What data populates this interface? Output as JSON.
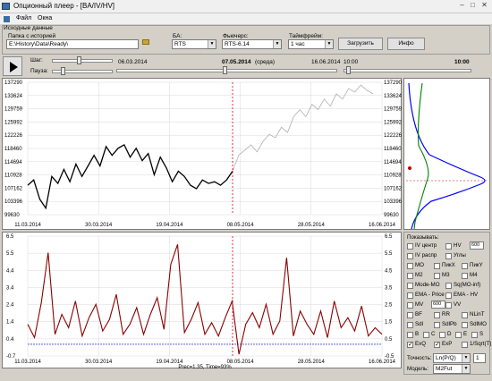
{
  "window": {
    "title": "Опционный плеер - [BA/IV/HV]"
  },
  "menu": [
    "Файл",
    "Окна"
  ],
  "source": {
    "group_label": "Исходные данные",
    "folder_label": "Папка с историей",
    "folder_value": "E:\\History\\Data\\Ready\\",
    "ba_label": "БА:",
    "ba_value": "RTS",
    "futures_label": "Фьючерс:",
    "futures_value": "RTS-6.14",
    "timeframe_label": "Таймфрейм:",
    "timeframe_value": "1 час",
    "load_button": "Загрузить",
    "info_button": "Инфо"
  },
  "player": {
    "step_label": "Шаг:",
    "pause_label": "Пауза:",
    "start_date": "06.03.2014",
    "current_date": "07.05.2014",
    "weekday": "(среда)",
    "end_date": "16.06.2014",
    "time_start": "10:00",
    "time_current": "10:00"
  },
  "top_chart": {
    "y_ticks": [
      "137290",
      "133624",
      "129759",
      "125992",
      "122226",
      "118460",
      "114694",
      "110928",
      "107162",
      "103396",
      "99630"
    ],
    "x_ticks": [
      "11.03.2014",
      "30.03.2014",
      "19.04.2014",
      "08.05.2014",
      "28.05.2014",
      "16.06.2014"
    ],
    "colors": {
      "history": "#000000",
      "future": "#b0b0b0",
      "cursor": "#e00000"
    },
    "chart_data": {
      "type": "line",
      "series": [
        {
          "values": [
            108000,
            109500,
            104000,
            101500,
            110500,
            108500,
            112500,
            109000,
            114000,
            110500,
            113500,
            116500,
            113500,
            119000,
            116500,
            118500,
            119500,
            116000,
            118500,
            115000,
            117000,
            111000,
            116000,
            113000,
            109000,
            112000,
            110500,
            108000,
            107000,
            109500,
            108500,
            109000,
            108000,
            109500,
            112000
          ]
        },
        {
          "values": [
            112000,
            116500,
            118000,
            119500,
            117500,
            120500,
            122500,
            121500,
            124500,
            123000,
            127500,
            129500,
            127500,
            131000,
            129500,
            132500,
            130500,
            134000,
            132500,
            135500,
            134500,
            136500,
            135000,
            134000
          ]
        }
      ]
    }
  },
  "bottom_chart": {
    "left_ticks": [
      "6.5",
      "5.5",
      "4.4",
      "3.4",
      "2.4",
      "1.4",
      "0.4",
      "-0.7"
    ],
    "right_ticks": [
      "6.5",
      "5.5",
      "4.5",
      "3.5",
      "2.5",
      "1.5",
      "0.5",
      "-0.5"
    ],
    "x_ticks": [
      "11.03.2014",
      "30.03.2014",
      "19.04.2014",
      "08.05.2014",
      "28.05.2014",
      "16.06.2014"
    ],
    "status": "Prec=1.35, Time=93%",
    "colors": {
      "line": "#8b0000",
      "zero": "#0000c0",
      "cursor": "#e00000"
    },
    "chart_data": {
      "type": "line",
      "series": [
        {
          "values": [
            1.2,
            0.4,
            2.5,
            5.5,
            0.6,
            1.8,
            1.0,
            2.6,
            0.5,
            1.6,
            2.4,
            0.8,
            1.5,
            3.0,
            0.6,
            1.2,
            2.2,
            0.6,
            1.8,
            2.8,
            0.9,
            4.8,
            6.0,
            0.7,
            1.5,
            2.5,
            0.6,
            1.3,
            0.5,
            1.6,
            2.6,
            -0.6,
            1.2,
            1.9,
            1.0,
            2.4,
            0.6,
            1.4,
            5.2,
            0.5,
            2.0,
            1.2,
            0.6,
            2.0,
            0.4,
            2.6,
            1.0,
            1.6,
            0.8,
            2.3,
            0.5,
            1.0,
            0.6
          ]
        }
      ]
    }
  },
  "display": {
    "title": "Показывать:",
    "rows": [
      [
        {
          "label": "IV центр",
          "on": false
        },
        {
          "label": "HV",
          "on": false,
          "value": "600"
        }
      ],
      [
        {
          "label": "IV распр",
          "on": false
        },
        {
          "label": "Углы",
          "on": false
        }
      ],
      [
        {
          "label": "MO",
          "on": false
        },
        {
          "label": "ПикX",
          "on": false
        },
        {
          "label": "ПикY",
          "on": false
        }
      ],
      [
        {
          "label": "M2",
          "on": false
        },
        {
          "label": "M3",
          "on": false
        },
        {
          "label": "M4",
          "on": false
        }
      ],
      [
        {
          "label": "Mode-MO",
          "on": false
        },
        {
          "label": "Sq(MO-inf)",
          "on": false
        }
      ],
      [
        {
          "label": "EMA - Price",
          "on": false
        },
        {
          "label": "EMA - HV",
          "on": false
        }
      ],
      [
        {
          "label": "MV",
          "on": false,
          "value": "600"
        },
        {
          "label": "VV",
          "on": false
        }
      ],
      [
        {
          "label": "BF",
          "on": false
        },
        {
          "label": "RR",
          "on": false
        },
        {
          "label": "NLinT",
          "on": false
        }
      ],
      [
        {
          "label": "Sdl",
          "on": false
        },
        {
          "label": "SdlPb",
          "on": false
        },
        {
          "label": "SdlMO",
          "on": false
        }
      ],
      [
        {
          "label": "B",
          "on": false
        },
        {
          "label": "C",
          "on": false
        },
        {
          "label": "D",
          "on": false
        },
        {
          "label": "E",
          "on": false
        },
        {
          "label": "S",
          "on": false
        }
      ],
      [
        {
          "label": "ExQ",
          "on": true
        },
        {
          "label": "ExP",
          "on": true
        },
        {
          "label": "1/Sqrt(T)",
          "on": false
        }
      ]
    ],
    "accuracy_label": "Точность:",
    "accuracy_value": "Ln(P/Q)",
    "accuracy_num": "1",
    "model_label": "Модель:",
    "model_value": "M2Fut"
  }
}
